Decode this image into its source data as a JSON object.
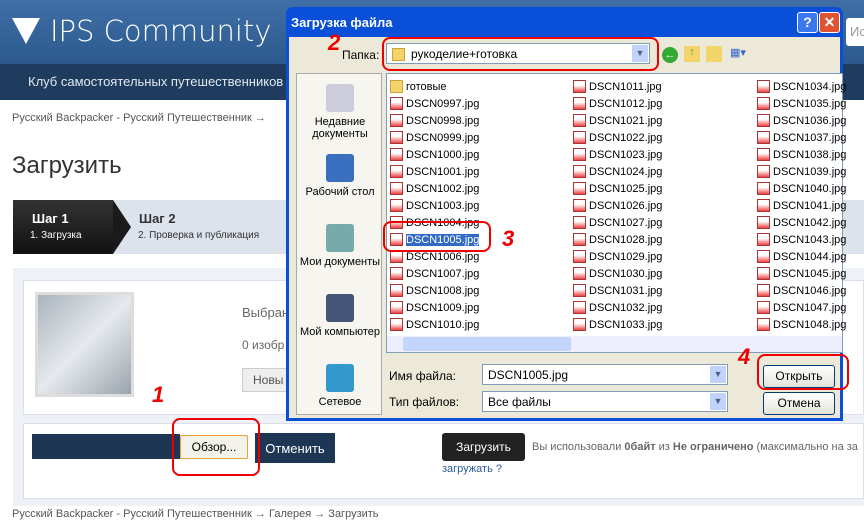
{
  "site": {
    "logo": "IPS Community",
    "search_placeholder": "Ис",
    "nav_title": "Клуб самостоятельных путешественников",
    "breadcrumb_top": "Русский Backpacker - Русский Путешественник  →",
    "page_title": "Загрузить",
    "steps": [
      {
        "title": "Шаг 1",
        "sub": "1. Загрузка"
      },
      {
        "title": "Шаг 2",
        "sub": "2. Проверка и публикация"
      }
    ],
    "selected_label": "Выбран",
    "count_label": "0 изобр",
    "new_button": "Новы",
    "browse_button": "Обзор...",
    "cancel_button": "Отменить",
    "upload_button": "Загрузить",
    "quota": {
      "pre": "Вы использовали ",
      "used": "0байт",
      "mid": " из ",
      "limit": "Не ограничено",
      "post": " (максимально на за"
    },
    "help_link": "загружать ?",
    "breadcrumb_bottom": [
      "Русский Backpacker - Русский Путешественник",
      "Галерея",
      "Загрузить"
    ]
  },
  "dialog": {
    "title": "Загрузка файла",
    "help": "?",
    "close": "✕",
    "folder_label": "Папка:",
    "folder": "рукоделие+готовка",
    "places": [
      "Недавние документы",
      "Рабочий стол",
      "Мои документы",
      "Мой компьютер",
      "Сетевое"
    ],
    "columns": [
      [
        "готовые",
        "DSCN0997.jpg",
        "DSCN0998.jpg",
        "DSCN0999.jpg",
        "DSCN1000.jpg",
        "DSCN1001.jpg",
        "DSCN1002.jpg",
        "DSCN1003.jpg",
        "DSCN1004.jpg",
        "DSCN1005.jpg",
        "DSCN1006.jpg",
        "DSCN1007.jpg",
        "DSCN1008.jpg",
        "DSCN1009.jpg",
        "DSCN1010.jpg"
      ],
      [
        "DSCN1011.jpg",
        "DSCN1012.jpg",
        "DSCN1021.jpg",
        "DSCN1022.jpg",
        "DSCN1023.jpg",
        "DSCN1024.jpg",
        "DSCN1025.jpg",
        "DSCN1026.jpg",
        "DSCN1027.jpg",
        "DSCN1028.jpg",
        "DSCN1029.jpg",
        "DSCN1030.jpg",
        "DSCN1031.jpg",
        "DSCN1032.jpg",
        "DSCN1033.jpg"
      ],
      [
        "DSCN1034.jpg",
        "DSCN1035.jpg",
        "DSCN1036.jpg",
        "DSCN1037.jpg",
        "DSCN1038.jpg",
        "DSCN1039.jpg",
        "DSCN1040.jpg",
        "DSCN1041.jpg",
        "DSCN1042.jpg",
        "DSCN1043.jpg",
        "DSCN1044.jpg",
        "DSCN1045.jpg",
        "DSCN1046.jpg",
        "DSCN1047.jpg",
        "DSCN1048.jpg"
      ]
    ],
    "selected_file": "DSCN1005.jpg",
    "filename_label": "Имя файла:",
    "filename": "DSCN1005.jpg",
    "filetype_label": "Тип файлов:",
    "filetype": "Все файлы",
    "open_button": "Открыть",
    "cancel_button": "Отмена"
  },
  "annotations": [
    "1",
    "2",
    "3",
    "4"
  ],
  "colors": {
    "annotation": "#ee0000",
    "titlebar": "#0a4fd8",
    "header": "#3a6aa0"
  }
}
